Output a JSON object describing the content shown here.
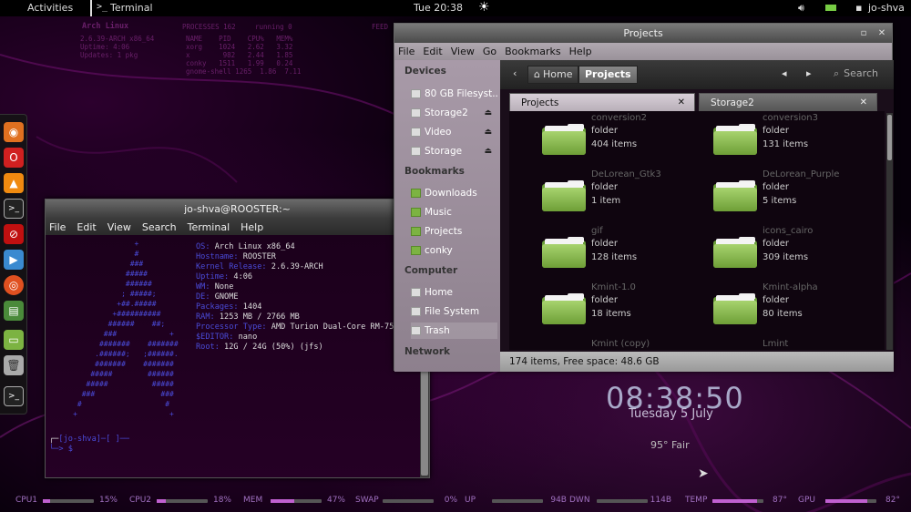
{
  "topbar": {
    "activities": "Activities",
    "app_name": "Terminal",
    "clock": "Tue 20:38",
    "user": "jo-shva"
  },
  "conky_top": {
    "title": "Arch Linux",
    "col1_header": "PROCESSES 162",
    "col2_header": "running 0",
    "col3_header": "FEED",
    "line1": "2.6.39-ARCH x86_64",
    "line2": "Uptime: 4:06",
    "line3": "Updates: 1 pkg",
    "proc_header": "NAME    PID    CPU%   MEM%",
    "proc_rows": [
      "xorg    1024   2.62   3.32",
      "x        982   2.44   1.85",
      "conky   1511   1.99   0.24",
      "gnome-shell 1265  1.86  7.11"
    ]
  },
  "dock": {
    "items": [
      "firefox",
      "opera",
      "vlc",
      "terminal",
      "blocked",
      "media",
      "lifebuoy",
      "monitor",
      "folder",
      "trash",
      "terminal2"
    ]
  },
  "terminal": {
    "title": "jo-shva@ROOSTER:~",
    "menu": [
      "File",
      "Edit",
      "View",
      "Search",
      "Terminal",
      "Help"
    ],
    "info": [
      {
        "key": "OS:",
        "val": " Arch Linux x86_64"
      },
      {
        "key": "Hostname:",
        "val": " ROOSTER"
      },
      {
        "key": "Kernel Release:",
        "val": " 2.6.39-ARCH"
      },
      {
        "key": "Uptime:",
        "val": " 4:06"
      },
      {
        "key": "WM:",
        "val": " None"
      },
      {
        "key": "DE:",
        "val": " GNOME"
      },
      {
        "key": "Packages:",
        "val": " 1404"
      },
      {
        "key": "RAM:",
        "val": " 1253 MB / 2766 MB"
      },
      {
        "key": "Processor Type:",
        "val": " AMD Turion Dual-Core RM-75"
      },
      {
        "key": "$EDITOR:",
        "val": " nano"
      },
      {
        "key": "Root:",
        "val": " 12G / 24G (50%) (jfs)"
      }
    ],
    "prompt_line1": "[jo-shva]─[ ]──",
    "prompt_line2": "└─> $"
  },
  "file_manager": {
    "title": "Projects",
    "menu": [
      "File",
      "Edit",
      "View",
      "Go",
      "Bookmarks",
      "Help"
    ],
    "devices_header": "Devices",
    "devices": [
      "80 GB Filesyst...",
      "Storage2",
      "Video",
      "Storage"
    ],
    "bookmarks_header": "Bookmarks",
    "bookmarks": [
      "Downloads",
      "Music",
      "Projects",
      "conky"
    ],
    "computer_header": "Computer",
    "computer": [
      "Home",
      "File System",
      "Trash"
    ],
    "network_header": "Network",
    "toolbar_home": "Home",
    "toolbar_projects": "Projects",
    "search_label": "Search",
    "tabs": [
      "Projects",
      "Storage2"
    ],
    "items": [
      {
        "name": "conversion2",
        "kind": "folder",
        "count": "404 items"
      },
      {
        "name": "conversion3",
        "kind": "folder",
        "count": "131 items"
      },
      {
        "name": "DeLorean_Gtk3",
        "kind": "folder",
        "count": "1 item"
      },
      {
        "name": "DeLorean_Purple",
        "kind": "folder",
        "count": "5 items"
      },
      {
        "name": "gif",
        "kind": "folder",
        "count": "128 items"
      },
      {
        "name": "icons_cairo",
        "kind": "folder",
        "count": "309 items"
      },
      {
        "name": "Kmint-1.0",
        "kind": "folder",
        "count": "18 items"
      },
      {
        "name": "Kmint-alpha",
        "kind": "folder",
        "count": "80 items"
      },
      {
        "name": "Kmint (copy)",
        "kind": "",
        "count": ""
      },
      {
        "name": "Lmint",
        "kind": "",
        "count": ""
      }
    ],
    "status": "174 items, Free space: 48.6 GB"
  },
  "desktop_clock": {
    "time": "08:38:50",
    "date": "Tuesday  5 July",
    "weather": "95° Fair"
  },
  "conky_bar": [
    {
      "label": "CPU1",
      "value": "15%",
      "level": 0.15
    },
    {
      "label": "CPU2",
      "value": "18%",
      "level": 0.18
    },
    {
      "label": "MEM",
      "value": "47%",
      "level": 0.47
    },
    {
      "label": "SWAP",
      "value": "0%",
      "level": 0.0
    },
    {
      "label": "UP",
      "value": "94B",
      "level": 0.0
    },
    {
      "label": "DWN",
      "value": "114B",
      "level": 0.0
    },
    {
      "label": "TEMP",
      "value": "87°",
      "level": 0.87
    },
    {
      "label": "GPU",
      "value": "82°",
      "level": 0.82
    }
  ],
  "colors": {
    "accent": "#c060d0",
    "terminal_key": "#4a4ad8",
    "folder_green": "#8cbf52"
  }
}
